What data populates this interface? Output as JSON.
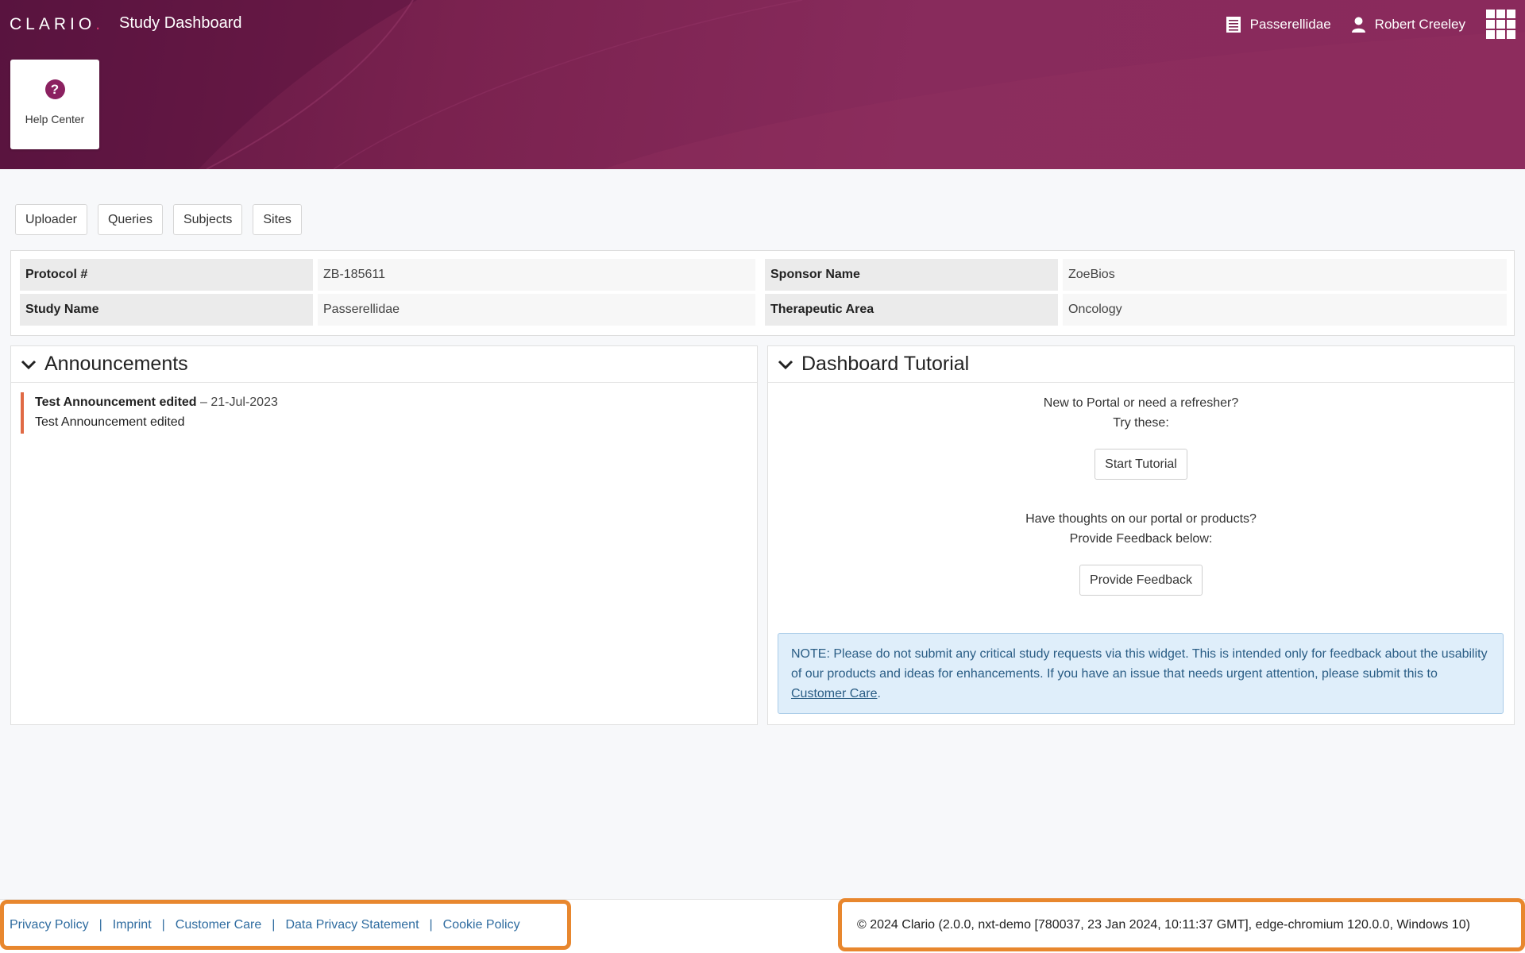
{
  "header": {
    "logo": "CLARIO",
    "logo_dot": ".",
    "title": "Study Dashboard",
    "study_selector": "Passerellidae",
    "user_name": "Robert Creeley"
  },
  "help_card": {
    "label": "Help Center",
    "icon_glyph": "?"
  },
  "nav": {
    "tabs": [
      "Uploader",
      "Queries",
      "Subjects",
      "Sites"
    ]
  },
  "study_info": {
    "protocol_label": "Protocol #",
    "protocol_value": "ZB-185611",
    "sponsor_label": "Sponsor Name",
    "sponsor_value": "ZoeBios",
    "study_name_label": "Study Name",
    "study_name_value": "Passerellidae",
    "therapeutic_label": "Therapeutic Area",
    "therapeutic_value": "Oncology"
  },
  "announcements": {
    "title": "Announcements",
    "items": [
      {
        "title": "Test Announcement edited",
        "date": " – 21-Jul-2023",
        "body": "Test Announcement edited"
      }
    ]
  },
  "tutorial": {
    "title": "Dashboard Tutorial",
    "intro_line1": "New to Portal or need a refresher?",
    "intro_line2": "Try these:",
    "start_button": "Start Tutorial",
    "feedback_line1": "Have thoughts on our portal or products?",
    "feedback_line2": "Provide Feedback below:",
    "feedback_button": "Provide Feedback",
    "note_text": "NOTE: Please do not submit any critical study requests via this widget. This is intended only for feedback about the usability of our products and ideas for enhancements. If you have an issue that needs urgent attention, please submit this to ",
    "note_link": "Customer Care",
    "note_end": "."
  },
  "footer": {
    "links": [
      "Privacy Policy",
      "Imprint",
      "Customer Care",
      "Data Privacy Statement",
      "Cookie Policy"
    ],
    "separator": "|",
    "copyright": "© 2024 Clario (2.0.0, nxt-demo [780037, 23 Jan 2024, 10:11:37 GMT], edge-chromium 120.0.0, Windows 10)"
  },
  "colors": {
    "header_start": "#5e1642",
    "header_end": "#8a2a5c",
    "accent": "#8b2160",
    "announcement_bar": "#e06a45",
    "footer_highlight": "#e8872e",
    "link": "#2f6ca0"
  }
}
